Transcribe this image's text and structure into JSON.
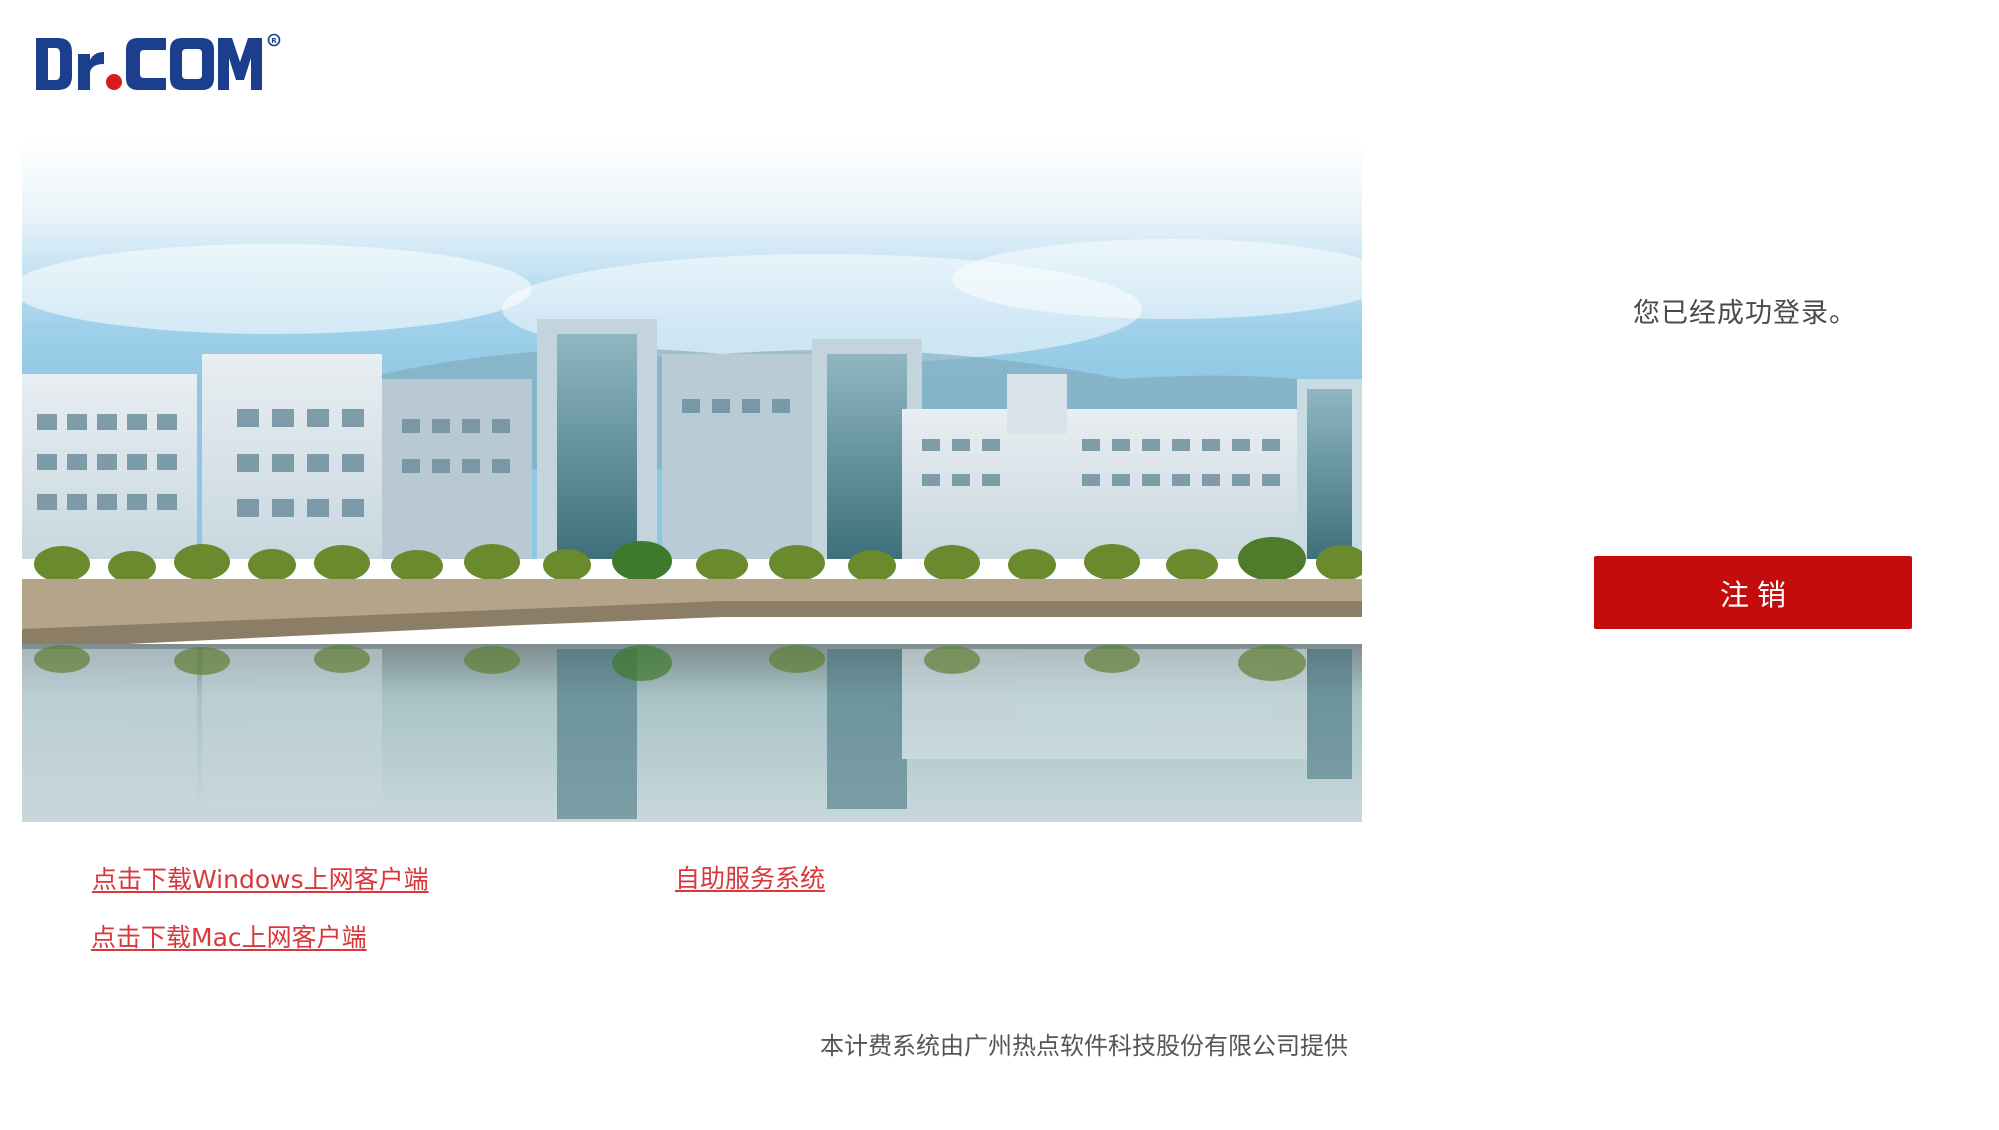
{
  "brand": {
    "logo_text": "Dr.COM",
    "logo_registered_mark": "®",
    "logo_colors": {
      "letters": "#1b3f8c",
      "dot": "#d61c1c"
    }
  },
  "banner": {
    "image_icon": "campus-photo"
  },
  "status": {
    "message": "您已经成功登录。"
  },
  "actions": {
    "logout_label": "注销",
    "logout_color": "#c40c0c"
  },
  "links": {
    "windows_client": "点击下载Windows上网客户端",
    "mac_client": "点击下载Mac上网客户端",
    "self_service": "自助服务系统",
    "link_color": "#d8383c"
  },
  "footer": {
    "provider_text": "本计费系统由广州热点软件科技股份有限公司提供"
  }
}
